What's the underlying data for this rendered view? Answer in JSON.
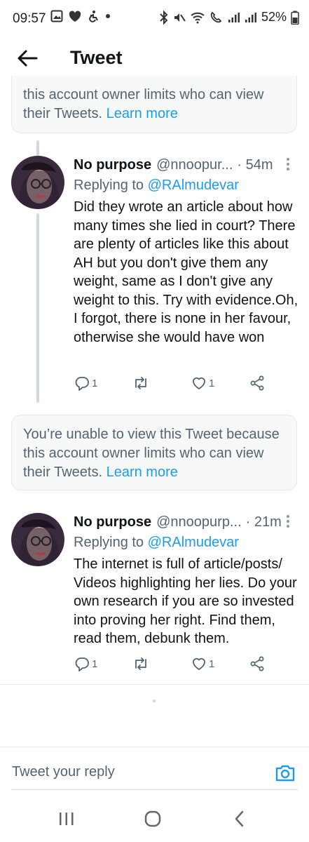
{
  "status_bar": {
    "time": "09:57",
    "battery": "52%",
    "left_icons": [
      "gallery-icon",
      "heart-icon",
      "accessibility-icon",
      "dot-icon"
    ],
    "right_icons": [
      "bluetooth-icon",
      "mute-icon",
      "wifi-icon",
      "wifi-calling-icon",
      "signal-icon",
      "signal-icon-2",
      "battery-icon"
    ]
  },
  "header": {
    "title": "Tweet"
  },
  "notices": [
    {
      "text": "this account owner limits who can view their Tweets.",
      "link": "Learn more"
    },
    {
      "text": "You’re unable to view this Tweet because this account owner limits who can view their Tweets.",
      "link": "Learn more"
    }
  ],
  "tweets": [
    {
      "name": "No purpose",
      "handle": "@nnoopur...",
      "time": "· 54m",
      "replying_prefix": "Replying to",
      "replying_handle": "@RAlmudevar",
      "text": "Did they wrote an article about how many times she lied in court? There are plenty of articles like this about AH but you don't give them any weight, same as I don't give any weight to this. Try with evidence.Oh, I forgot, there is none in her favour, otherwise she would have won",
      "replies": "1",
      "retweets": "",
      "likes": "1"
    },
    {
      "name": "No purpose",
      "handle": "@nnoopurp...",
      "time": "· 21m",
      "replying_prefix": "Replying to",
      "replying_handle": "@RAlmudevar",
      "text": "The internet is full of article/posts/ Videos highlighting her lies. Do your own research if you are so invested into proving her right. Find them, read them, debunk them.",
      "replies": "1",
      "retweets": "",
      "likes": "1"
    }
  ],
  "composer": {
    "placeholder": "Tweet your reply"
  },
  "colors": {
    "accent": "#1d9bf0",
    "secondary_text": "#536471",
    "notice_bg": "#f7f9f9"
  }
}
